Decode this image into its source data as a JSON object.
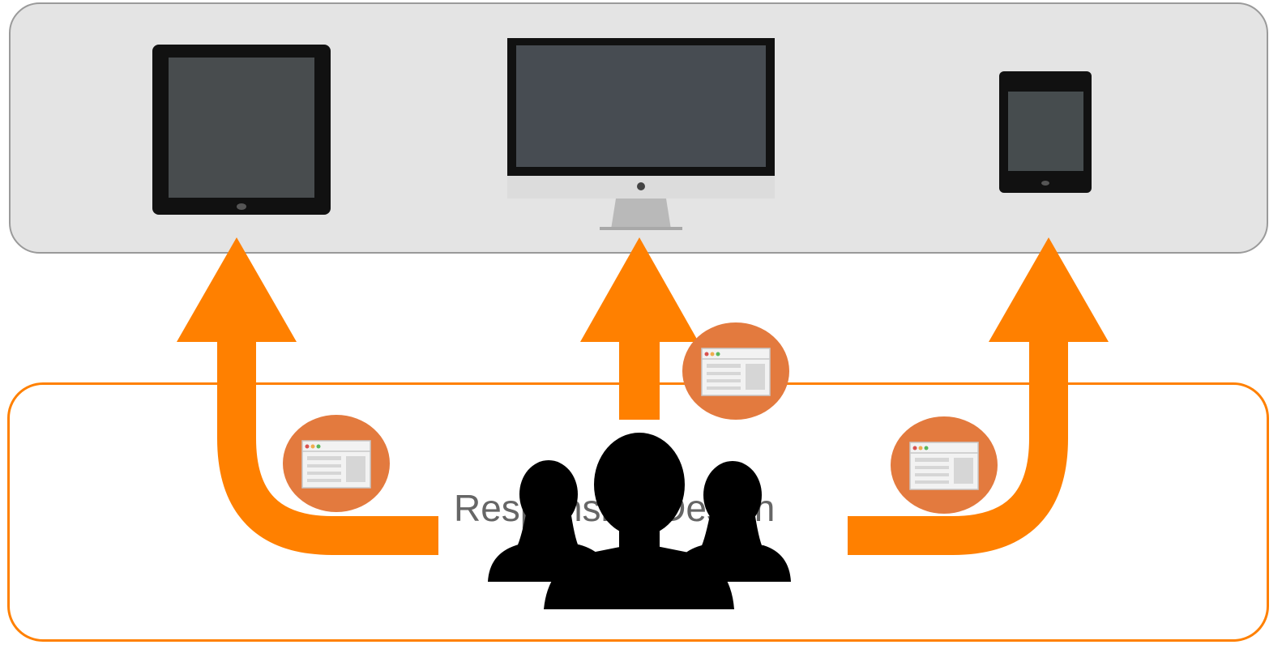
{
  "caption": "Responsive Design",
  "colors": {
    "accent": "#ff8000",
    "icon_circle": "#e37a3e",
    "panel_fill": "#e4e4e4",
    "panel_border": "#9a9a9a",
    "device_body": "#111111",
    "device_screen": "#464b4e",
    "people": "#000000"
  },
  "icons": [
    "tablet-icon",
    "desktop-monitor-icon",
    "small-tablet-icon",
    "web-page-icon",
    "people-group-icon",
    "up-arrow-icon"
  ]
}
